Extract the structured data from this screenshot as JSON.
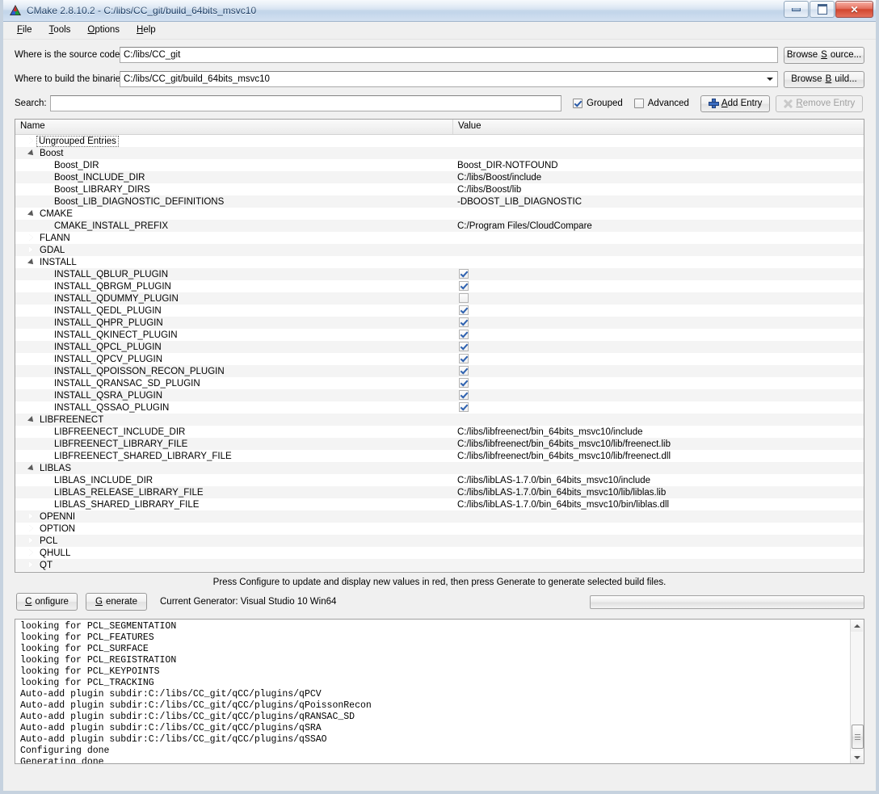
{
  "window": {
    "title": "CMake 2.8.10.2 - C:/libs/CC_git/build_64bits_msvc10",
    "minimize_label": "Minimize",
    "maximize_label": "Maximize",
    "close_label": "✕"
  },
  "menu": [
    {
      "label": "File",
      "mnemonic": "F"
    },
    {
      "label": "Tools",
      "mnemonic": "T"
    },
    {
      "label": "Options",
      "mnemonic": "O"
    },
    {
      "label": "Help",
      "mnemonic": "H"
    }
  ],
  "form": {
    "source_label": "Where is the source code:",
    "source_value": "C:/libs/CC_git",
    "browse_source_label": "Browse Source...",
    "build_label": "Where to build the binaries:",
    "build_value": "C:/libs/CC_git/build_64bits_msvc10",
    "browse_build_label": "Browse Build...",
    "search_label": "Search:",
    "search_value": "",
    "search_placeholder": "",
    "grouped_label": "Grouped",
    "grouped_checked": true,
    "advanced_label": "Advanced",
    "advanced_checked": false,
    "add_entry_label": "Add Entry",
    "remove_entry_label": "Remove Entry"
  },
  "table": {
    "col_name": "Name",
    "col_value": "Value",
    "rows": [
      {
        "kind": "group",
        "state": "collapsed",
        "name": "Ungrouped Entries",
        "value": "",
        "focused": true
      },
      {
        "kind": "group",
        "state": "expanded",
        "name": "Boost",
        "value": ""
      },
      {
        "kind": "item",
        "name": "Boost_DIR",
        "value": "Boost_DIR-NOTFOUND"
      },
      {
        "kind": "item",
        "name": "Boost_INCLUDE_DIR",
        "value": "C:/libs/Boost/include"
      },
      {
        "kind": "item",
        "name": "Boost_LIBRARY_DIRS",
        "value": "C:/libs/Boost/lib"
      },
      {
        "kind": "item",
        "name": "Boost_LIB_DIAGNOSTIC_DEFINITIONS",
        "value": "-DBOOST_LIB_DIAGNOSTIC"
      },
      {
        "kind": "group",
        "state": "expanded",
        "name": "CMAKE",
        "value": ""
      },
      {
        "kind": "item",
        "name": "CMAKE_INSTALL_PREFIX",
        "value": "C:/Program Files/CloudCompare"
      },
      {
        "kind": "group",
        "state": "collapsed",
        "name": "FLANN",
        "value": ""
      },
      {
        "kind": "group",
        "state": "collapsed",
        "name": "GDAL",
        "value": ""
      },
      {
        "kind": "group",
        "state": "expanded",
        "name": "INSTALL",
        "value": ""
      },
      {
        "kind": "check",
        "name": "INSTALL_QBLUR_PLUGIN",
        "checked": true
      },
      {
        "kind": "check",
        "name": "INSTALL_QBRGM_PLUGIN",
        "checked": true
      },
      {
        "kind": "check",
        "name": "INSTALL_QDUMMY_PLUGIN",
        "checked": false
      },
      {
        "kind": "check",
        "name": "INSTALL_QEDL_PLUGIN",
        "checked": true
      },
      {
        "kind": "check",
        "name": "INSTALL_QHPR_PLUGIN",
        "checked": true
      },
      {
        "kind": "check",
        "name": "INSTALL_QKINECT_PLUGIN",
        "checked": true
      },
      {
        "kind": "check",
        "name": "INSTALL_QPCL_PLUGIN",
        "checked": true
      },
      {
        "kind": "check",
        "name": "INSTALL_QPCV_PLUGIN",
        "checked": true
      },
      {
        "kind": "check",
        "name": "INSTALL_QPOISSON_RECON_PLUGIN",
        "checked": true
      },
      {
        "kind": "check",
        "name": "INSTALL_QRANSAC_SD_PLUGIN",
        "checked": true
      },
      {
        "kind": "check",
        "name": "INSTALL_QSRA_PLUGIN",
        "checked": true
      },
      {
        "kind": "check",
        "name": "INSTALL_QSSAO_PLUGIN",
        "checked": true
      },
      {
        "kind": "group",
        "state": "expanded",
        "name": "LIBFREENECT",
        "value": ""
      },
      {
        "kind": "item",
        "name": "LIBFREENECT_INCLUDE_DIR",
        "value": "C:/libs/libfreenect/bin_64bits_msvc10/include"
      },
      {
        "kind": "item",
        "name": "LIBFREENECT_LIBRARY_FILE",
        "value": "C:/libs/libfreenect/bin_64bits_msvc10/lib/freenect.lib"
      },
      {
        "kind": "item",
        "name": "LIBFREENECT_SHARED_LIBRARY_FILE",
        "value": "C:/libs/libfreenect/bin_64bits_msvc10/lib/freenect.dll"
      },
      {
        "kind": "group",
        "state": "expanded",
        "name": "LIBLAS",
        "value": ""
      },
      {
        "kind": "item",
        "name": "LIBLAS_INCLUDE_DIR",
        "value": "C:/libs/libLAS-1.7.0/bin_64bits_msvc10/include"
      },
      {
        "kind": "item",
        "name": "LIBLAS_RELEASE_LIBRARY_FILE",
        "value": "C:/libs/libLAS-1.7.0/bin_64bits_msvc10/lib/liblas.lib"
      },
      {
        "kind": "item",
        "name": "LIBLAS_SHARED_LIBRARY_FILE",
        "value": "C:/libs/libLAS-1.7.0/bin_64bits_msvc10/bin/liblas.dll"
      },
      {
        "kind": "group",
        "state": "collapsed",
        "name": "OPENNI",
        "value": ""
      },
      {
        "kind": "group",
        "state": "collapsed",
        "name": "OPTION",
        "value": ""
      },
      {
        "kind": "group",
        "state": "collapsed",
        "name": "PCL",
        "value": ""
      },
      {
        "kind": "group",
        "state": "collapsed",
        "name": "QHULL",
        "value": ""
      },
      {
        "kind": "group",
        "state": "collapsed",
        "name": "QT",
        "value": ""
      }
    ]
  },
  "bottom": {
    "hint": "Press Configure to update and display new values in red, then press Generate to generate selected build files.",
    "configure_label": "Configure",
    "generate_label": "Generate",
    "generator_text": "Current Generator: Visual Studio 10 Win64",
    "progress_value": 0
  },
  "log": {
    "lines": [
      "looking for PCL_SEGMENTATION",
      "looking for PCL_FEATURES",
      "looking for PCL_SURFACE",
      "looking for PCL_REGISTRATION",
      "looking for PCL_KEYPOINTS",
      "looking for PCL_TRACKING",
      "Auto-add plugin subdir:C:/libs/CC_git/qCC/plugins/qPCV",
      "Auto-add plugin subdir:C:/libs/CC_git/qCC/plugins/qPoissonRecon",
      "Auto-add plugin subdir:C:/libs/CC_git/qCC/plugins/qRANSAC_SD",
      "Auto-add plugin subdir:C:/libs/CC_git/qCC/plugins/qSRA",
      "Auto-add plugin subdir:C:/libs/CC_git/qCC/plugins/qSSAO",
      "Configuring done",
      "Generating done"
    ]
  },
  "colors": {
    "accent": "#2f62b0",
    "row_alt": "#f4f4f4",
    "window_bg": "#f0f0f0"
  }
}
